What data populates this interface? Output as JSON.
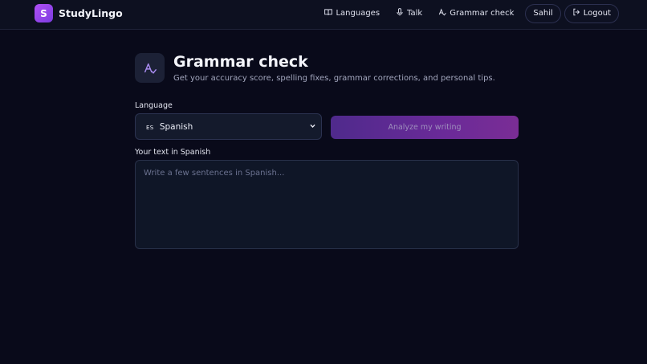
{
  "brand": {
    "logo_letter": "S",
    "name": "StudyLingo"
  },
  "nav": {
    "languages": "Languages",
    "talk": "Talk",
    "grammar_check": "Grammar check",
    "user": "Sahil",
    "logout": "Logout"
  },
  "page": {
    "title": "Grammar check",
    "subtitle": "Get your accuracy score, spelling fixes, grammar corrections, and personal tips."
  },
  "language_field": {
    "label": "Language",
    "selected_flag": "ES",
    "selected": "Spanish"
  },
  "analyze_button": {
    "label": "Analyze my writing"
  },
  "text_field": {
    "label": "Your text in Spanish",
    "placeholder": "Write a few sentences in Spanish..."
  },
  "colors": {
    "background": "#090a1a",
    "accent": "#7b3ce0",
    "accent_secondary": "#b04ff5"
  },
  "icons": [
    "book-icon",
    "mic-icon",
    "grammar-icon",
    "logout-icon",
    "chevron-down-icon"
  ]
}
